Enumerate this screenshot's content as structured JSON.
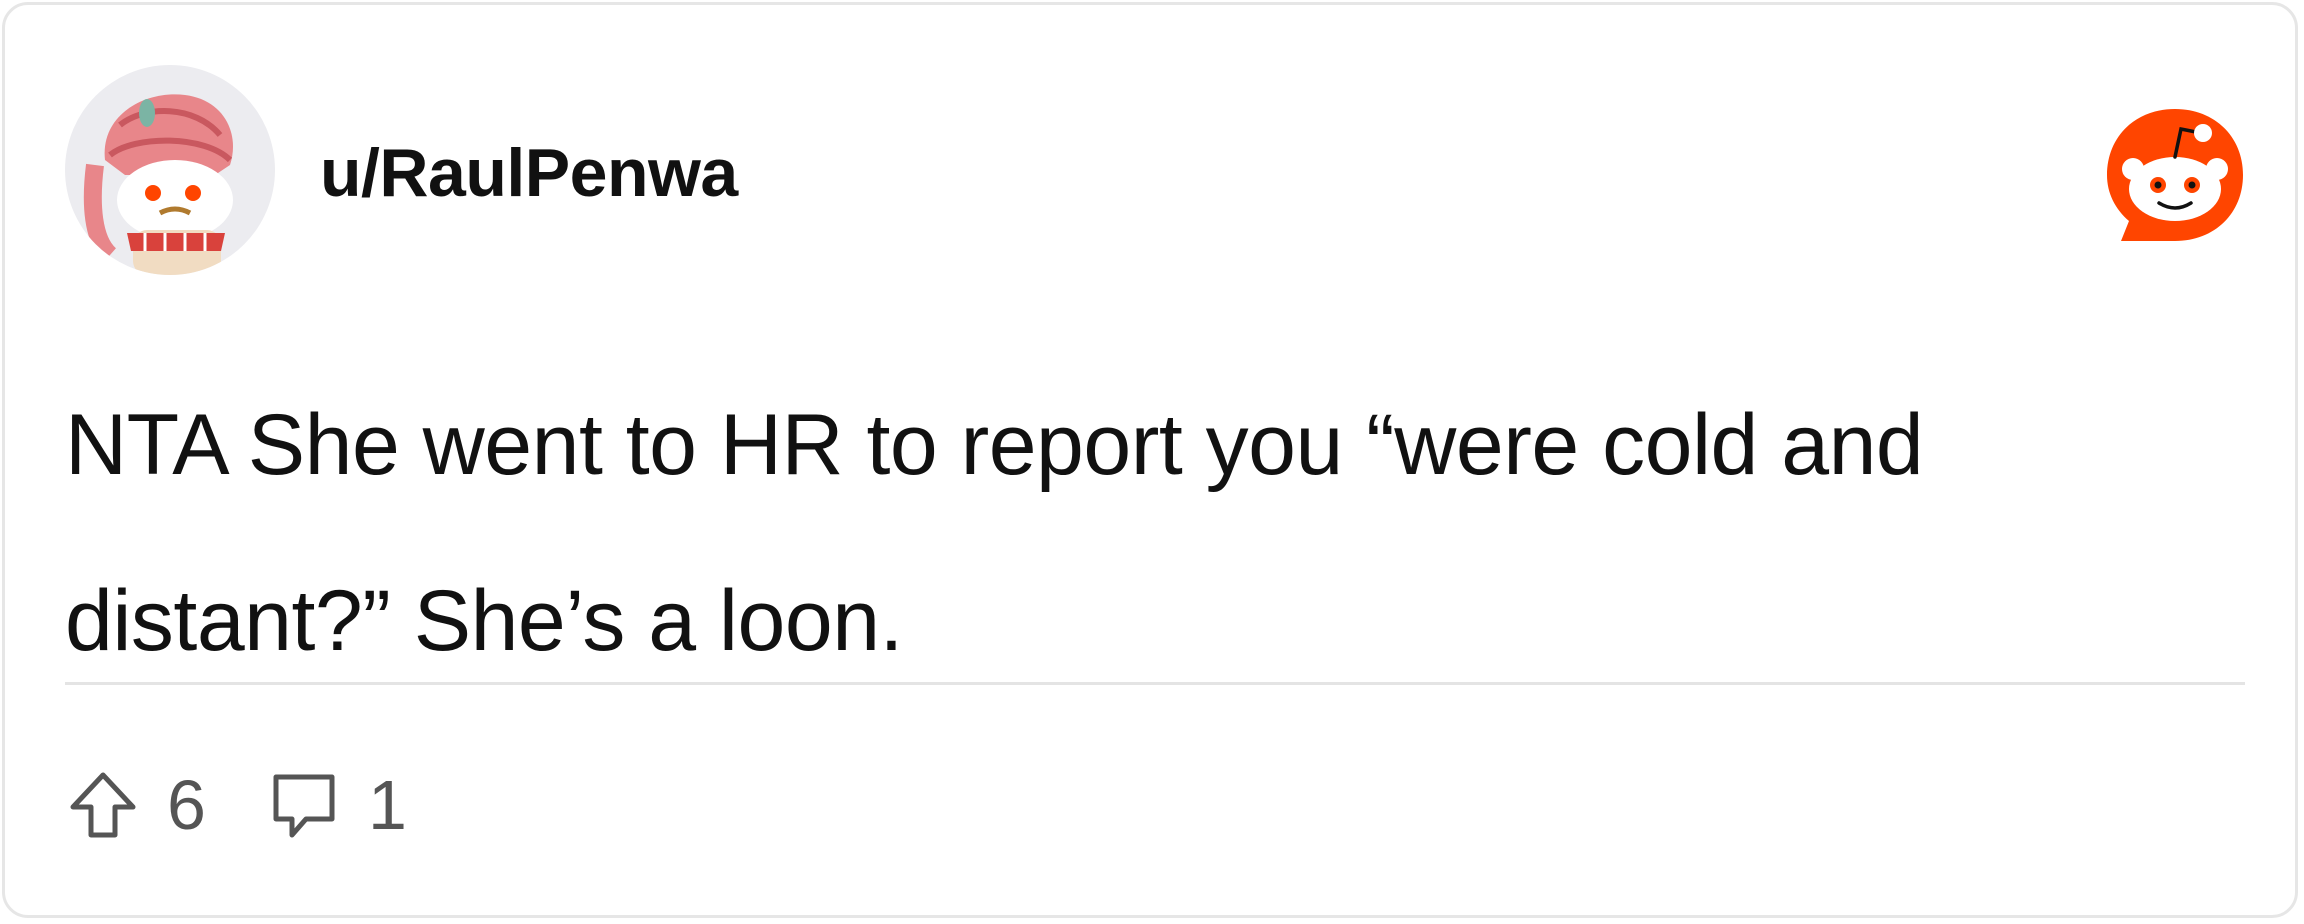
{
  "post": {
    "username": "u/RaulPenwa",
    "body_line1": "NTA She went to HR to report you “were cold and",
    "body_line2": "distant?” She’s a loon."
  },
  "footer": {
    "upvotes": "6",
    "comments": "1"
  },
  "icons": {
    "brand": "reddit-snoo-icon",
    "upvote": "upvote-arrow-icon",
    "comment": "comment-bubble-icon",
    "avatar": "user-avatar"
  },
  "colors": {
    "brand": "#ff4500",
    "text": "#111111",
    "muted": "#555555",
    "divider": "#e4e4e4"
  }
}
